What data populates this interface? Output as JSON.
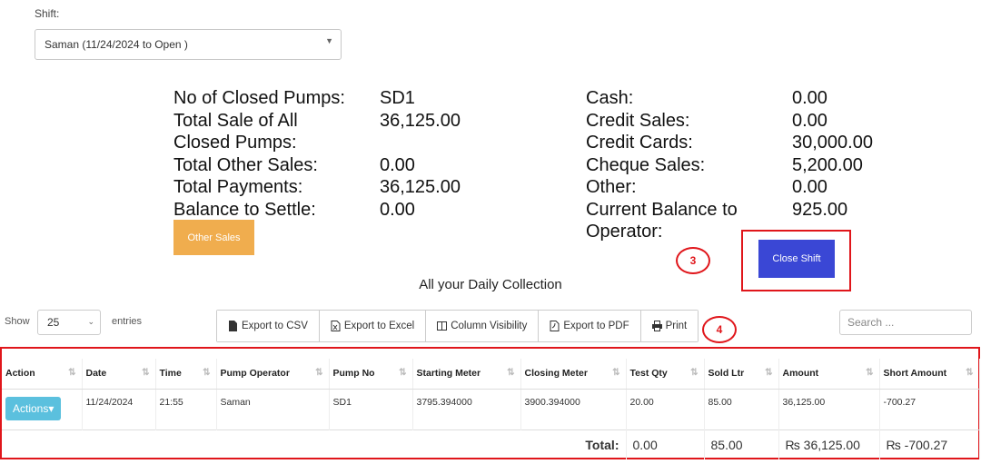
{
  "shift": {
    "label": "Shift:",
    "selected": "Saman (11/24/2024 to Open )"
  },
  "summary_left": [
    {
      "label": "No of Closed Pumps:",
      "value": "SD1"
    },
    {
      "label": "Total Sale of All",
      "value": "36,125.00"
    },
    {
      "label": "Closed Pumps:",
      "value": ""
    },
    {
      "label": "Total Other Sales:",
      "value": "0.00"
    },
    {
      "label": "Total Payments:",
      "value": "36,125.00"
    },
    {
      "label": "Balance to Settle:",
      "value": "0.00"
    }
  ],
  "summary_right": [
    {
      "label": "Cash:",
      "value": "0.00"
    },
    {
      "label": "Credit Sales:",
      "value": "0.00"
    },
    {
      "label": "Credit Cards:",
      "value": "30,000.00"
    },
    {
      "label": "Cheque Sales:",
      "value": "5,200.00"
    },
    {
      "label": "Other:",
      "value": "0.00"
    },
    {
      "label": "Current Balance to",
      "value": "925.00"
    },
    {
      "label": "Operator:",
      "value": ""
    }
  ],
  "buttons": {
    "other_sales": "Other Sales",
    "close_shift": "Close Shift"
  },
  "markers": {
    "m3": "3",
    "m4": "4"
  },
  "collection_title": "All your Daily Collection",
  "entries": {
    "show": "Show",
    "value": "25",
    "suffix": "entries"
  },
  "toolbar": {
    "csv": "Export to CSV",
    "excel": "Export to Excel",
    "columns": "Column Visibility",
    "pdf": "Export to PDF",
    "print": "Print"
  },
  "search": {
    "placeholder": "Search ..."
  },
  "table": {
    "headers": [
      "Action",
      "Date",
      "Time",
      "Pump Operator",
      "Pump No",
      "Starting Meter",
      "Closing Meter",
      "Test Qty",
      "Sold Ltr",
      "Amount",
      "Short Amount"
    ],
    "row": {
      "action": "Actions",
      "date": "11/24/2024",
      "time": "21:55",
      "operator": "Saman",
      "pump_no": "SD1",
      "starting_meter": "3795.394000",
      "closing_meter": "3900.394000",
      "test_qty": "20.00",
      "sold_ltr": "85.00",
      "amount": "36,125.00",
      "short_amount": "-700.27"
    },
    "total": {
      "label": "Total:",
      "test_qty": "0.00",
      "sold_ltr": "85.00",
      "amount": "₨ 36,125.00",
      "short_amount": "₨ -700.27"
    }
  }
}
